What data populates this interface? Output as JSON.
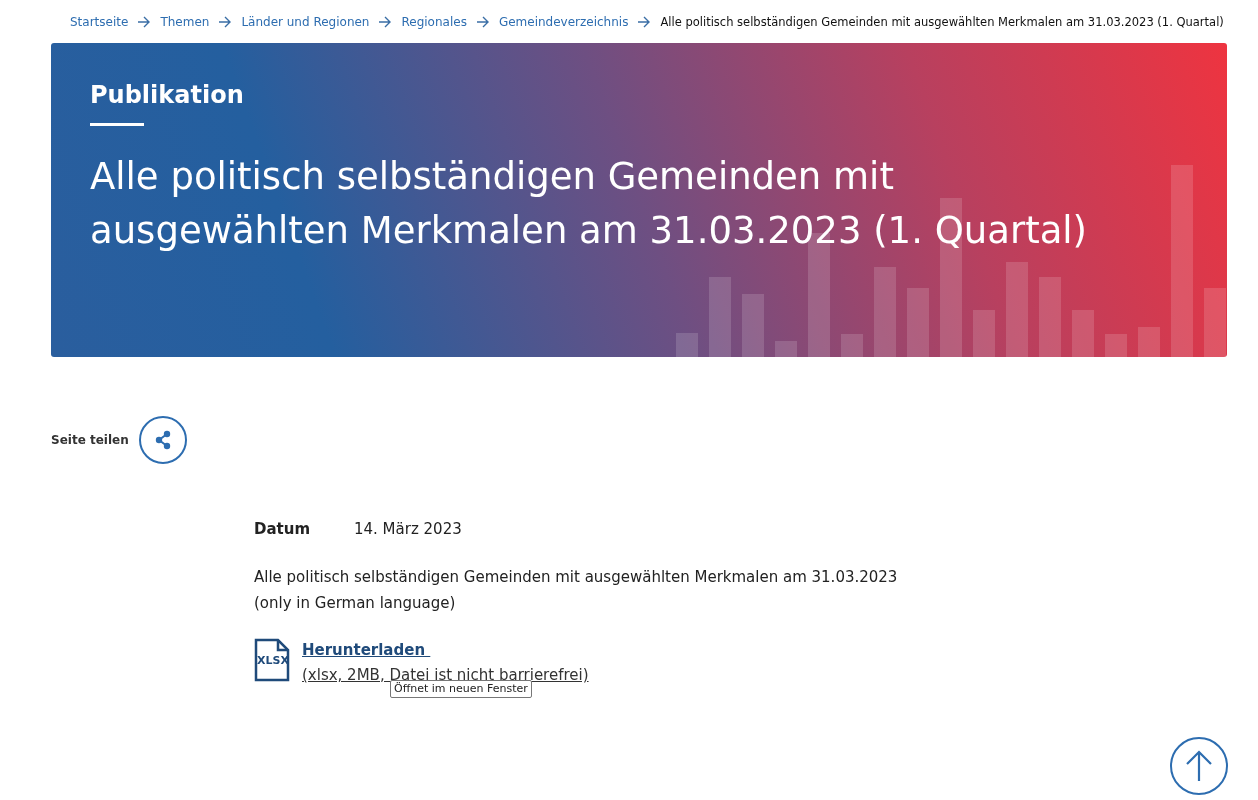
{
  "breadcrumb": [
    {
      "label": "Startseite",
      "kind": "link"
    },
    {
      "label": "Themen",
      "kind": "link"
    },
    {
      "label": "Länder und Regionen",
      "kind": "link"
    },
    {
      "label": "Regionales",
      "kind": "link"
    },
    {
      "label": "Gemeindeverzeichnis",
      "kind": "link"
    },
    {
      "label": "Alle politisch selbständigen Gemeinden mit ausgewählten Merkmalen am 31.03.2023 (1. Quartal)",
      "kind": "current"
    }
  ],
  "hero": {
    "eyebrow": "Publikation",
    "title": "Alle politisch selbständigen Gemeinden mit ausgewählten Merkmalen am 31.03.2023 (1. Quartal)"
  },
  "share": {
    "label": "Seite teilen"
  },
  "details": {
    "date_label": "Datum",
    "date_value": "14. März 2023",
    "description": "Alle politisch selbständigen Gemeinden mit ausgewählten Merkmalen am 31.03.2023",
    "note": "(only in German language)"
  },
  "download": {
    "file_type": "XLSX",
    "link": "Herunterladen ",
    "info": "(xlsx, 2MB, Datei ist nicht barrierefrei)",
    "tooltip": "Öffnet im neuen Fenster"
  }
}
